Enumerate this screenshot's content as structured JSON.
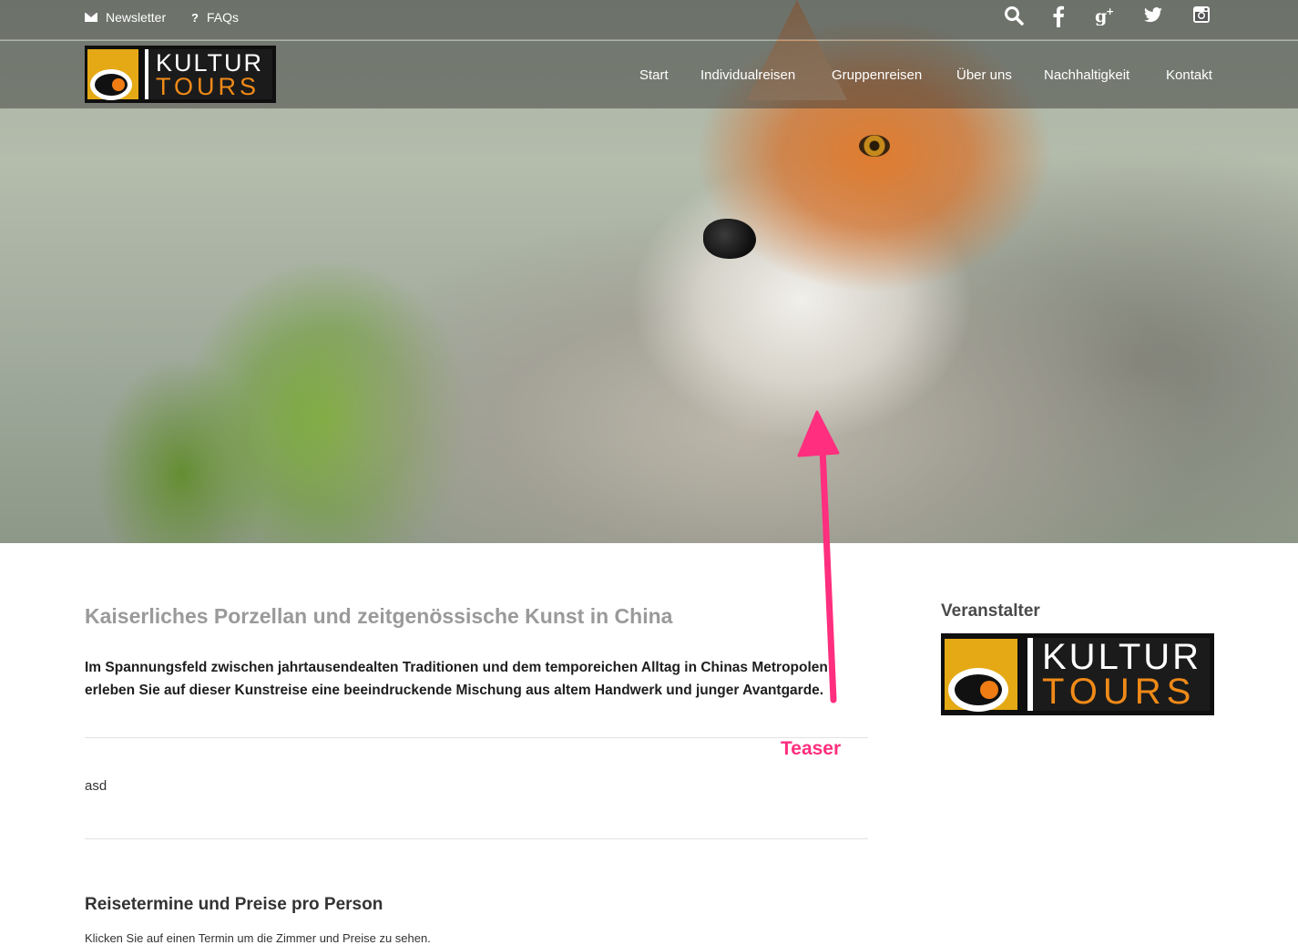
{
  "topbar": {
    "newsletter": "Newsletter",
    "faqs_icon": "?",
    "faqs": "FAQs",
    "social": [
      {
        "icon": "search-icon",
        "glyph": "⚲"
      },
      {
        "icon": "facebook-icon",
        "glyph": "f"
      },
      {
        "icon": "google-plus-icon",
        "glyph": "g+"
      },
      {
        "icon": "twitter-icon",
        "glyph": "🐦"
      },
      {
        "icon": "instagram-icon",
        "glyph": "◙"
      }
    ]
  },
  "logo": {
    "line1": "KULTUR",
    "line2": "TOURS"
  },
  "nav": [
    "Start",
    "Individualreisen",
    "Gruppenreisen",
    "Über uns",
    "Nachhaltigkeit",
    "Kontakt"
  ],
  "content": {
    "title": "Kaiserliches Porzellan und zeitgenössische Kunst in China",
    "lead": "Im Spannungsfeld zwischen jahrtausendealten Traditionen und dem temporeichen Alltag in Chinas Metropolen erleben Sie auf dieser Kunstreise eine beeindruckende Mischung aus altem Handwerk und junger Avantgarde.",
    "body": "asd",
    "section_heading": "Reisetermine und Preise pro Person",
    "section_text": "Klicken Sie auf einen Termin um die Zimmer und Preise zu sehen."
  },
  "sidebar": {
    "heading": "Veranstalter"
  },
  "annotation": {
    "label": "Teaser",
    "color": "#ff2e7e"
  },
  "colors": {
    "brand_orange": "#f08a18",
    "brand_yellow": "#e4a915"
  }
}
